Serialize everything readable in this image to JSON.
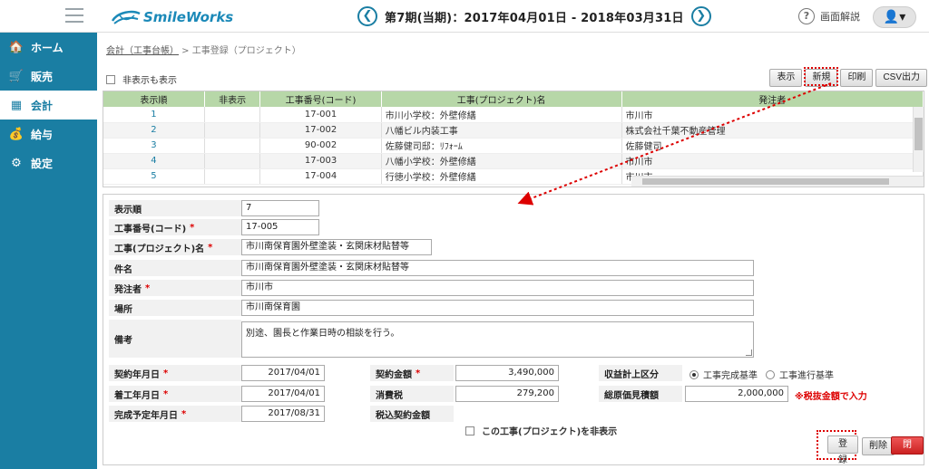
{
  "header": {
    "brand": "SmileWorks",
    "period": "第7期(当期)：2017年04月01日 - 2018年03月31日",
    "prev_glyph": "❮",
    "next_glyph": "❯",
    "help_label": "画面解説",
    "help_glyph": "?",
    "user_glyph": "👤▾"
  },
  "sidebar": {
    "items": [
      {
        "label": "ホーム",
        "icon": "home-icon",
        "glyph": "🏠",
        "active": false
      },
      {
        "label": "販売",
        "icon": "cart-icon",
        "glyph": "🛒",
        "active": false
      },
      {
        "label": "会計",
        "icon": "calculator-icon",
        "glyph": "▦",
        "active": true
      },
      {
        "label": "給与",
        "icon": "money-bag-icon",
        "glyph": "💰",
        "active": false
      },
      {
        "label": "設定",
        "icon": "gear-icon",
        "glyph": "⚙",
        "active": false
      }
    ]
  },
  "breadcrumb": {
    "parent": "会計（工事台帳）",
    "separator": " > ",
    "current": "工事登録（プロジェクト）"
  },
  "toolbar": {
    "show_hidden_label": "非表示も表示",
    "buttons": [
      "表示",
      "新規",
      "印刷",
      "CSV出力"
    ]
  },
  "list": {
    "columns": [
      "表示順",
      "非表示",
      "工事番号(コード)",
      "工事(プロジェクト)名",
      "発注者"
    ],
    "rows": [
      [
        "1",
        "",
        "17-001",
        "市川小学校：外壁修繕",
        "市川市"
      ],
      [
        "2",
        "",
        "17-002",
        "八幡ビル内装工事",
        "株式会社千葉不動産管理"
      ],
      [
        "3",
        "",
        "90-002",
        "佐藤健司邸：ﾘﾌｫｰﾑ",
        "佐藤健司"
      ],
      [
        "4",
        "",
        "17-003",
        "八幡小学校：外壁修繕",
        "市川市"
      ],
      [
        "5",
        "",
        "17-004",
        "行徳小学校：外壁修繕",
        "市川市"
      ]
    ]
  },
  "form": {
    "display_order_label": "表示順",
    "display_order": "7",
    "code_label": "工事番号(コード)",
    "code": "17-005",
    "name_label": "工事(プロジェクト)名",
    "name": "市川南保育園外壁塗装・玄関床材貼替等",
    "subject_label": "件名",
    "subject": "市川南保育園外壁塗装・玄関床材貼替等",
    "client_label": "発注者",
    "client": "市川市",
    "place_label": "場所",
    "place": "市川南保育園",
    "remarks_label": "備考",
    "remarks": "別途、園長と作業日時の相談を行う。",
    "contract_date_label": "契約年月日",
    "contract_date": "2017/04/01",
    "start_date_label": "着工年月日",
    "start_date": "2017/04/01",
    "end_date_label": "完成予定年月日",
    "end_date": "2017/08/31",
    "contract_amount_label": "契約金額",
    "contract_amount": "3,490,000",
    "tax_label": "消費税",
    "tax": "279,200",
    "total_label": "税込契約金額",
    "revenue_label": "収益計上区分",
    "revenue_opt1": "工事完成基準",
    "revenue_opt2": "工事進行基準",
    "cost_label": "総原価見積額",
    "cost": "2,000,000",
    "cost_note": "※税抜金額で入力",
    "hide_label": "この工事(プロジェクト)を非表示",
    "required_mark": "*"
  },
  "actions": {
    "register": "登録",
    "delete": "削除",
    "close": "閉じる"
  },
  "colors": {
    "sidebar": "#1a7ea3",
    "table_header": "#b7d7a8",
    "required": "#dd0000",
    "close_button": "#cc2222"
  }
}
